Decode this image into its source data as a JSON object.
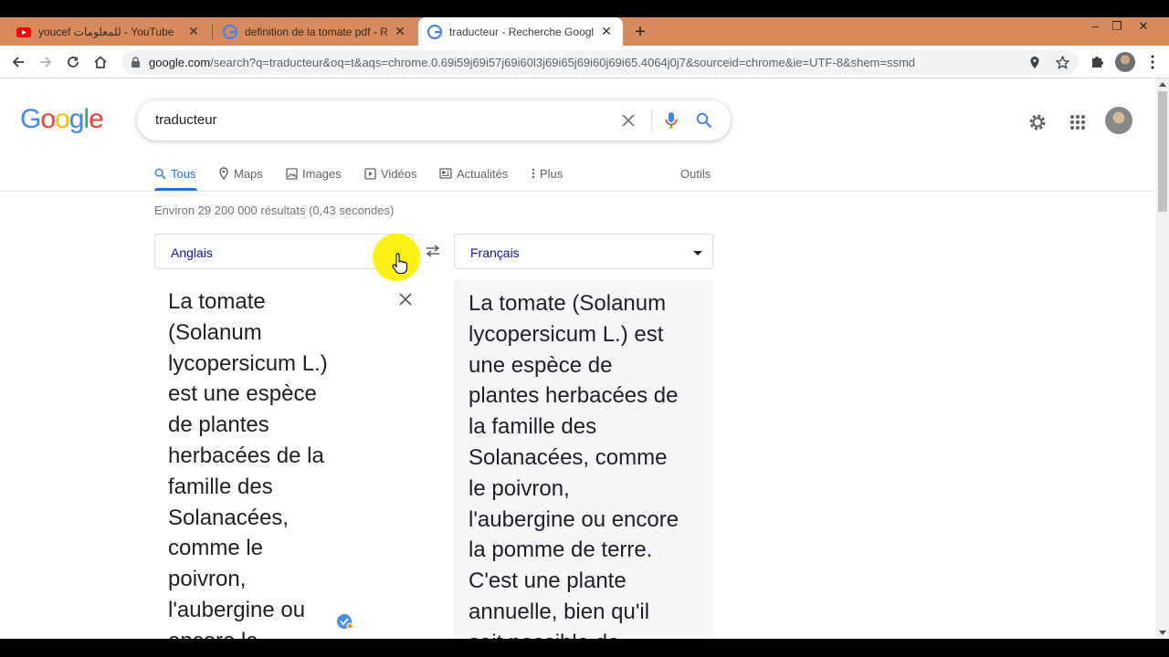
{
  "browser": {
    "tabs": [
      {
        "title": "youcef للمعلومات - YouTube",
        "icon": "youtube-icon",
        "active": false
      },
      {
        "title": "definition de la tomate pdf - Rec",
        "icon": "google-g-icon",
        "active": false
      },
      {
        "title": "traducteur - Recherche Google",
        "icon": "google-g-icon",
        "active": true
      }
    ],
    "new_tab": "+",
    "url_domain": "google.com",
    "url_path": "/search?q=traducteur&oq=t&aqs=chrome.0.69i59j69i57j69i60l3j69i65j69i60j69i65.4064j0j7&sourceid=chrome&ie=UTF-8&shem=ssmd"
  },
  "google": {
    "logo_letters": [
      "G",
      "o",
      "o",
      "g",
      "l",
      "e"
    ],
    "logo_colors": [
      "#4285f4",
      "#ea4335",
      "#fbbc05",
      "#4285f4",
      "#34a853",
      "#ea4335"
    ],
    "query": "traducteur",
    "nav_tabs": [
      {
        "label": "Tous",
        "icon": "search-icon",
        "active": true
      },
      {
        "label": "Maps",
        "icon": "map-pin-icon",
        "active": false
      },
      {
        "label": "Images",
        "icon": "image-icon",
        "active": false
      },
      {
        "label": "Vidéos",
        "icon": "video-icon",
        "active": false
      },
      {
        "label": "Actualités",
        "icon": "news-icon",
        "active": false
      },
      {
        "label": "Plus",
        "icon": "more-vert-icon",
        "active": false
      }
    ],
    "tools_label": "Outils",
    "result_stats": "Environ 29 200 000 résultats (0,43 secondes)"
  },
  "translator": {
    "source_lang": "Anglais",
    "target_lang": "Français",
    "source_lines": [
      "La tomate",
      "(Solanum",
      "lycopersicum L.)",
      "est une espèce",
      "de plantes",
      "herbacées de la",
      "famille des",
      "Solanacées,",
      "comme le",
      "poivron,",
      "l'aubergine ou",
      "encore la"
    ],
    "target_lines": [
      "La tomate (Solanum",
      "lycopersicum L.) est",
      "une espèce de",
      "plantes herbacées de",
      "la famille des",
      "Solanacées, comme",
      "le poivron,",
      "l'aubergine ou encore",
      "la pomme de terre.",
      "C'est une plante",
      "annuelle, bien qu'il",
      "soit possible de"
    ]
  },
  "colors": {
    "accent": "#1a73e8",
    "tab_strip": "#d68a5e",
    "highlight": "#fef100"
  }
}
